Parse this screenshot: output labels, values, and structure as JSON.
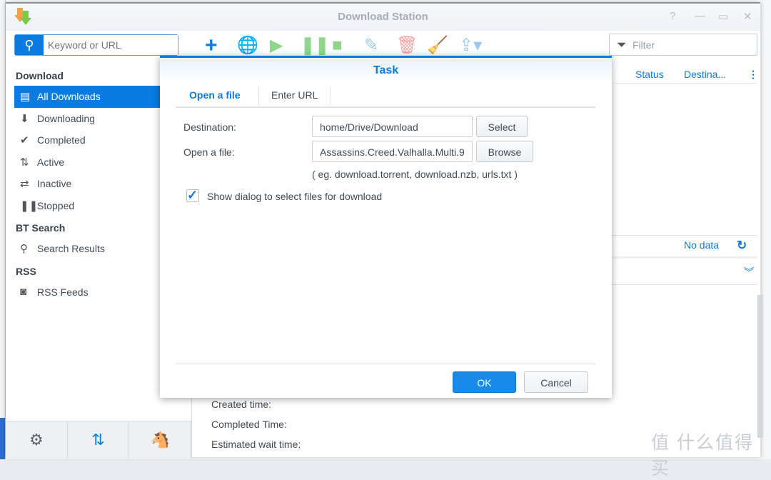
{
  "window": {
    "title": "Download Station"
  },
  "search": {
    "placeholder": "Keyword or URL"
  },
  "filter": {
    "placeholder": "Filter"
  },
  "toolbar": [
    "add-icon",
    "add-url-icon",
    "start-icon",
    "pause-icon",
    "stop-icon",
    "edit-icon",
    "delete-icon",
    "clear-icon",
    "share-icon"
  ],
  "sidebar": {
    "sections": [
      {
        "title": "Download",
        "items": [
          {
            "label": "All Downloads",
            "selected": true
          },
          {
            "label": "Downloading"
          },
          {
            "label": "Completed"
          },
          {
            "label": "Active"
          },
          {
            "label": "Inactive"
          },
          {
            "label": "Stopped"
          }
        ]
      },
      {
        "title": "BT Search",
        "items": [
          {
            "label": "Search Results"
          }
        ]
      },
      {
        "title": "RSS",
        "items": [
          {
            "label": "RSS Feeds"
          }
        ]
      }
    ]
  },
  "grid": {
    "columns": [
      "Status",
      "Destina..."
    ],
    "status": "No data"
  },
  "details": {
    "labels": [
      "Created time:",
      "Completed Time:",
      "Estimated wait time:"
    ]
  },
  "dialog": {
    "title": "Task",
    "tabs": [
      "Open a file",
      "Enter URL"
    ],
    "destination_label": "Destination:",
    "destination_value": "home/Drive/Download",
    "select_label": "Select",
    "open_file_label": "Open a file:",
    "open_file_value": "Assassins.Creed.Valhalla.Multi.9",
    "browse_label": "Browse",
    "hint": "( eg. download.torrent, download.nzb, urls.txt )",
    "checkbox_label": "Show dialog to select files for download",
    "checkbox_checked": true,
    "ok_label": "OK",
    "cancel_label": "Cancel"
  },
  "watermark": "值 什么值得买",
  "colors": {
    "accent": "#0a7be0"
  }
}
